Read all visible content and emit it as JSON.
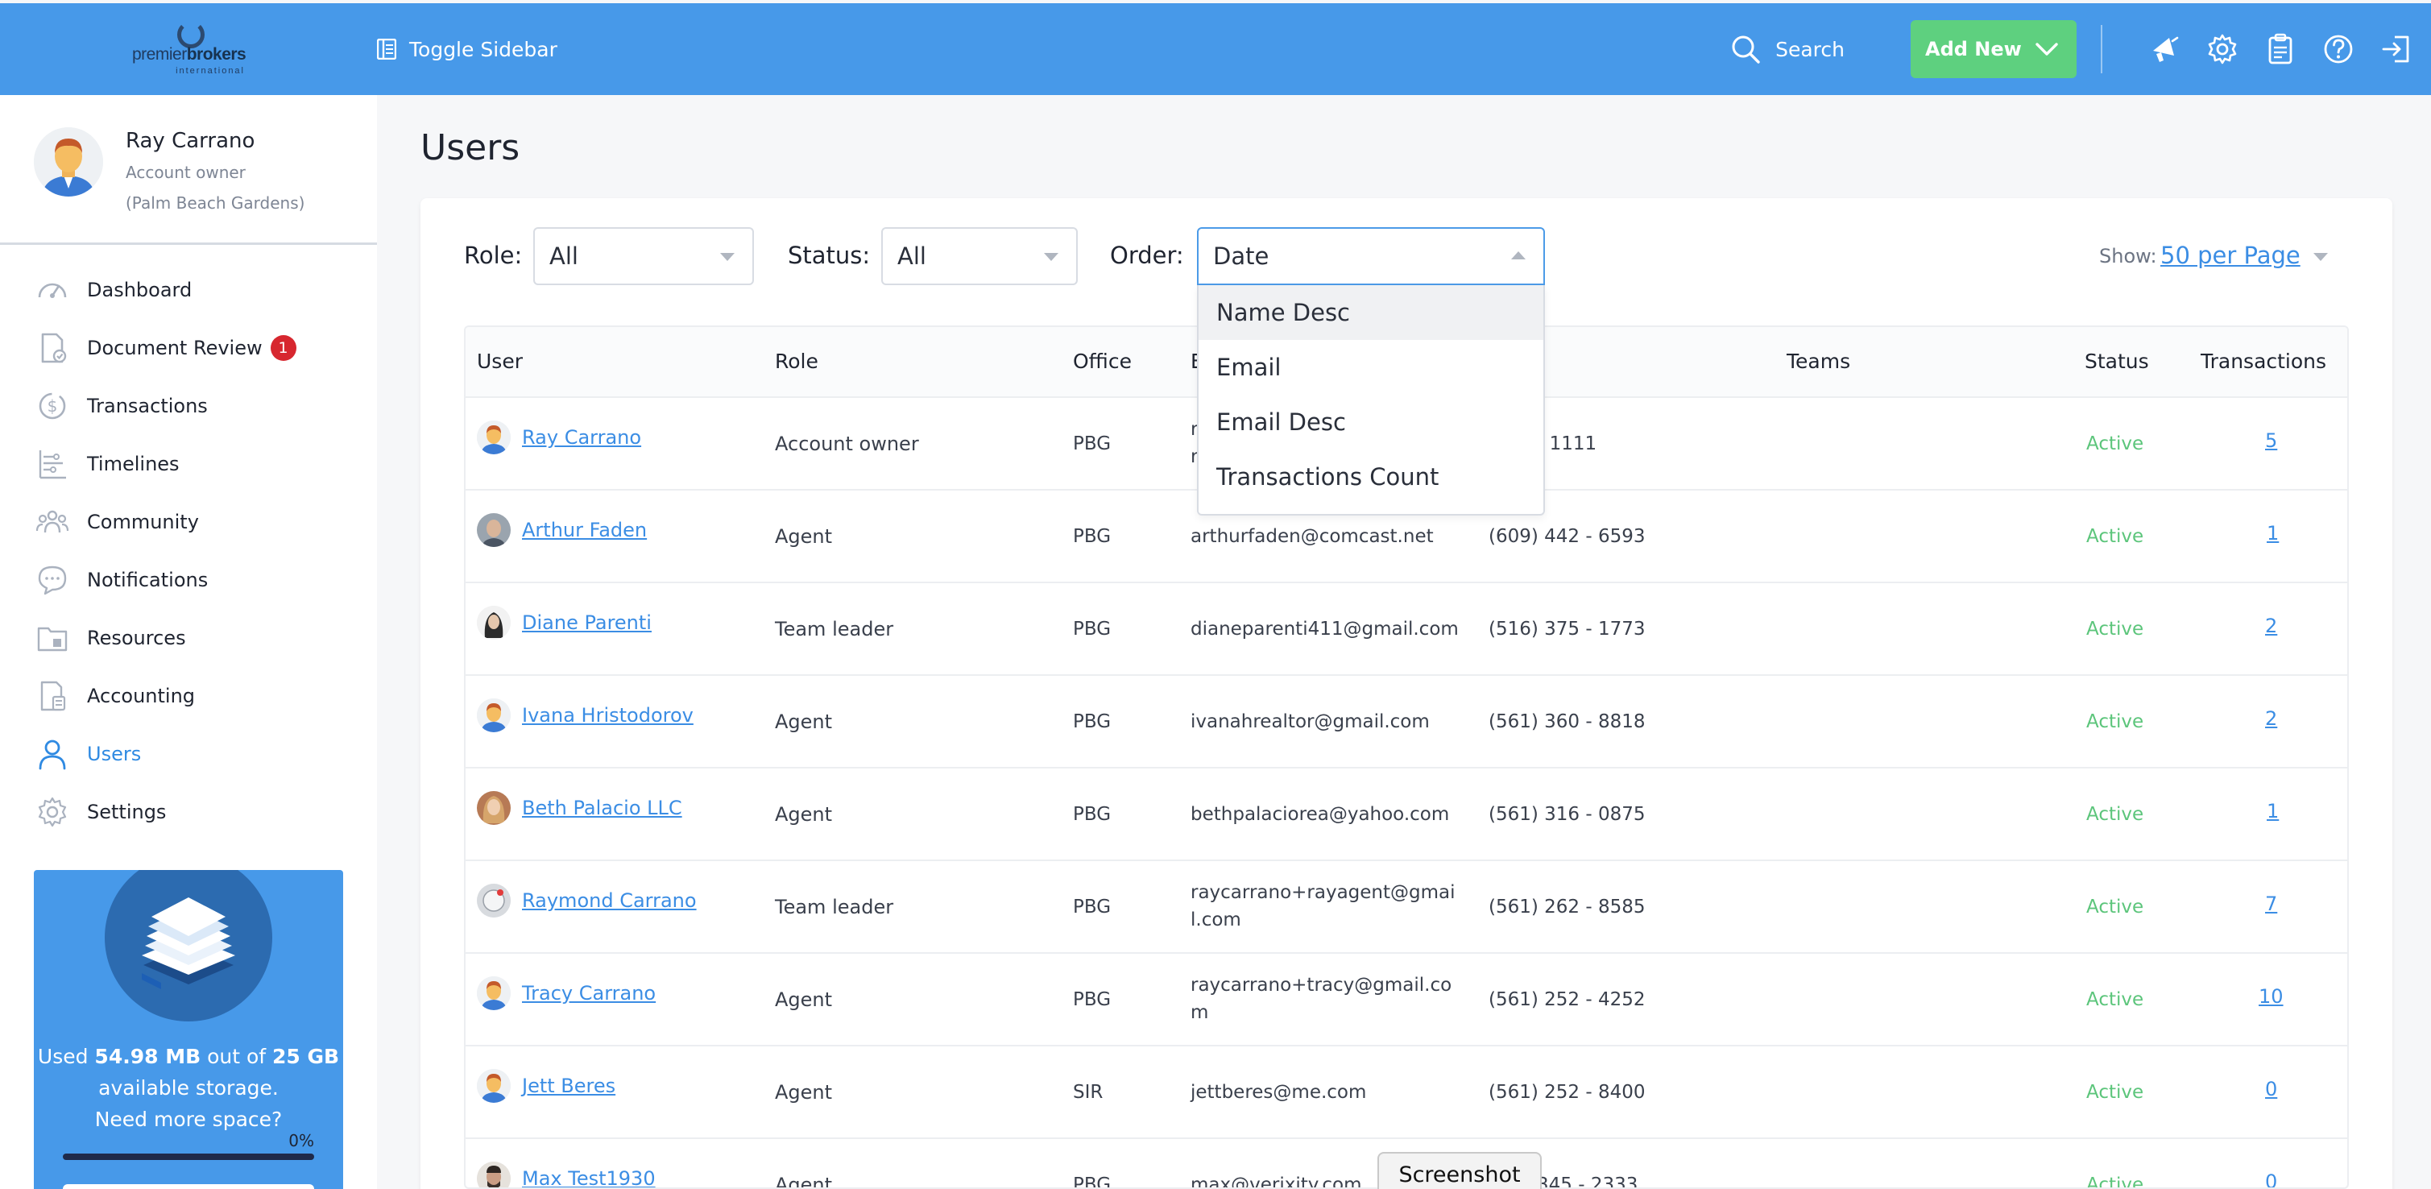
{
  "topbar": {
    "logo_text_a": "premier",
    "logo_text_b": "brokers",
    "logo_sub": "international",
    "toggle_label": "Toggle Sidebar",
    "search_label": "Search",
    "add_new_label": "Add New",
    "brand_color": "#4799e9",
    "add_new_color": "#5ed07f"
  },
  "profile": {
    "name": "Ray Carrano",
    "role": "Account owner",
    "office": "(Palm Beach Gardens)"
  },
  "nav": [
    {
      "label": "Dashboard",
      "icon": "gauge-icon"
    },
    {
      "label": "Document Review",
      "icon": "document-check-icon",
      "badge": "1"
    },
    {
      "label": "Transactions",
      "icon": "dollar-coin-icon"
    },
    {
      "label": "Timelines",
      "icon": "timeline-icon"
    },
    {
      "label": "Community",
      "icon": "people-group-icon"
    },
    {
      "label": "Notifications",
      "icon": "chat-bubble-icon"
    },
    {
      "label": "Resources",
      "icon": "folder-icon"
    },
    {
      "label": "Accounting",
      "icon": "calculator-doc-icon"
    },
    {
      "label": "Users",
      "icon": "user-icon",
      "active": true
    },
    {
      "label": "Settings",
      "icon": "gear-icon"
    }
  ],
  "storage": {
    "pre": "Used ",
    "used": "54.98 MB",
    "mid": " out of ",
    "total": "25 GB",
    "post": " available storage.",
    "question": "Need more space?",
    "percent_label": "0%",
    "percent_value": 0
  },
  "page": {
    "title": "Users"
  },
  "filters": {
    "role_label": "Role:",
    "role_value": "All",
    "status_label": "Status:",
    "status_value": "All",
    "order_label": "Order:",
    "order_value": "Date",
    "order_options_visible": [
      "Name Desc",
      "Email",
      "Email Desc",
      "Transactions Count"
    ],
    "show_label": "Show:",
    "show_value": "50 per Page"
  },
  "table": {
    "headers": [
      "User",
      "Role",
      "Office",
      "E",
      "e",
      "Teams",
      "Status",
      "Transactions"
    ],
    "rows": [
      {
        "name": "Ray Carrano",
        "role": "Account owner",
        "office": "PBG",
        "email": "r\nr",
        "phone": "- 1111",
        "status": "Active",
        "tx": "5"
      },
      {
        "name": "Arthur Faden",
        "role": "Agent",
        "office": "PBG",
        "email": "arthurfaden@comcast.net",
        "phone": "(609) 442 - 6593",
        "status": "Active",
        "tx": "1"
      },
      {
        "name": "Diane Parenti",
        "role": "Team leader",
        "office": "PBG",
        "email": "dianeparenti411@gmail.com",
        "phone": "(516) 375 - 1773",
        "status": "Active",
        "tx": "2"
      },
      {
        "name": "Ivana Hristodorov",
        "role": "Agent",
        "office": "PBG",
        "email": "ivanahrealtor@gmail.com",
        "phone": "(561) 360 - 8818",
        "status": "Active",
        "tx": "2"
      },
      {
        "name": "Beth Palacio LLC",
        "role": "Agent",
        "office": "PBG",
        "email": "bethpalaciorea@yahoo.com",
        "phone": "(561) 316 - 0875",
        "status": "Active",
        "tx": "1"
      },
      {
        "name": "Raymond Carrano",
        "role": "Team leader",
        "office": "PBG",
        "email": "raycarrano+rayagent@gmai\nl.com",
        "phone": "(561) 262 - 8585",
        "status": "Active",
        "tx": "7"
      },
      {
        "name": "Tracy Carrano",
        "role": "Agent",
        "office": "PBG",
        "email": "raycarrano+tracy@gmail.co\nm",
        "phone": "(561) 252 - 4252",
        "status": "Active",
        "tx": "10"
      },
      {
        "name": "Jett Beres",
        "role": "Agent",
        "office": "SIR",
        "email": "jettberes@me.com",
        "phone": "(561) 252 - 8400",
        "status": "Active",
        "tx": "0"
      },
      {
        "name": "Max Test1930",
        "role": "Agent",
        "office": "PBG",
        "email": "max@verixity.com",
        "phone": "345 - 2333",
        "status": "Active",
        "tx": "0"
      }
    ]
  },
  "overlay": {
    "screenshot_tab": "Screenshot"
  }
}
